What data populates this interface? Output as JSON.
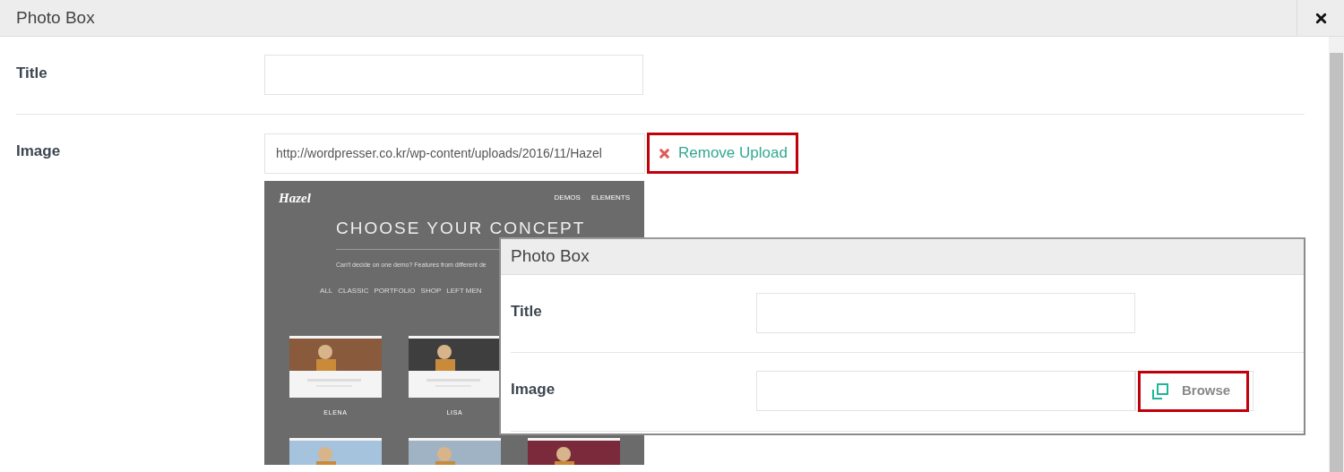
{
  "dialog": {
    "title": "Photo Box",
    "fields": [
      {
        "kind": "text",
        "label": "Title"
      },
      {
        "kind": "upload",
        "label": "Image",
        "value": "http://wordpresser.co.kr/wp-content/uploads/2016/11/Hazel",
        "action": "Remove Upload",
        "highlighted": true
      }
    ],
    "preview": {
      "logo": "Hazel",
      "nav": [
        "DEMOS",
        "ELEMENTS"
      ],
      "heading": "CHOOSE YOUR CONCEPT",
      "subtitle": "Can't decide on one demo? Features from different de",
      "filters": [
        "ALL",
        "CLASSIC",
        "PORTFOLIO",
        "SHOP",
        "LEFT MEN"
      ],
      "demos": [
        {
          "name": "ELENA"
        },
        {
          "name": "LISA"
        }
      ]
    }
  },
  "inset_dialog": {
    "title": "Photo Box",
    "fields": [
      {
        "kind": "text",
        "label": "Title"
      },
      {
        "kind": "browse",
        "label": "Image",
        "action": "Browse",
        "highlighted": true
      }
    ]
  }
}
